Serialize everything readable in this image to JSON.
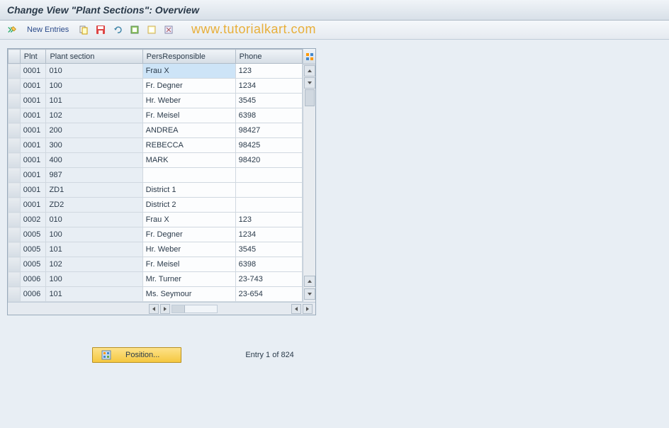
{
  "title": "Change View \"Plant Sections\": Overview",
  "watermark": "www.tutorialkart.com",
  "toolbar": {
    "new_entries_label": "New Entries"
  },
  "table": {
    "headers": {
      "plnt": "Plnt",
      "section": "Plant section",
      "pers": "PersResponsible",
      "phone": "Phone"
    },
    "rows": [
      {
        "plnt": "0001",
        "section": "010",
        "pers": "Frau X",
        "phone": "123",
        "hl": true
      },
      {
        "plnt": "0001",
        "section": "100",
        "pers": "Fr. Degner",
        "phone": "1234"
      },
      {
        "plnt": "0001",
        "section": "101",
        "pers": "Hr. Weber",
        "phone": "3545"
      },
      {
        "plnt": "0001",
        "section": "102",
        "pers": "Fr. Meisel",
        "phone": "6398"
      },
      {
        "plnt": "0001",
        "section": "200",
        "pers": "ANDREA",
        "phone": "98427"
      },
      {
        "plnt": "0001",
        "section": "300",
        "pers": "REBECCA",
        "phone": "98425"
      },
      {
        "plnt": "0001",
        "section": "400",
        "pers": "MARK",
        "phone": "98420"
      },
      {
        "plnt": "0001",
        "section": "987",
        "pers": "",
        "phone": ""
      },
      {
        "plnt": "0001",
        "section": "ZD1",
        "pers": "District 1",
        "phone": ""
      },
      {
        "plnt": "0001",
        "section": "ZD2",
        "pers": "District 2",
        "phone": ""
      },
      {
        "plnt": "0002",
        "section": "010",
        "pers": "Frau X",
        "phone": "123"
      },
      {
        "plnt": "0005",
        "section": "100",
        "pers": "Fr. Degner",
        "phone": "1234"
      },
      {
        "plnt": "0005",
        "section": "101",
        "pers": "Hr. Weber",
        "phone": "3545"
      },
      {
        "plnt": "0005",
        "section": "102",
        "pers": "Fr. Meisel",
        "phone": "6398"
      },
      {
        "plnt": "0006",
        "section": "100",
        "pers": "Mr. Turner",
        "phone": "23-743"
      },
      {
        "plnt": "0006",
        "section": "101",
        "pers": "Ms. Seymour",
        "phone": "23-654"
      }
    ]
  },
  "footer": {
    "position_label": "Position...",
    "entry_text": "Entry 1 of 824"
  }
}
